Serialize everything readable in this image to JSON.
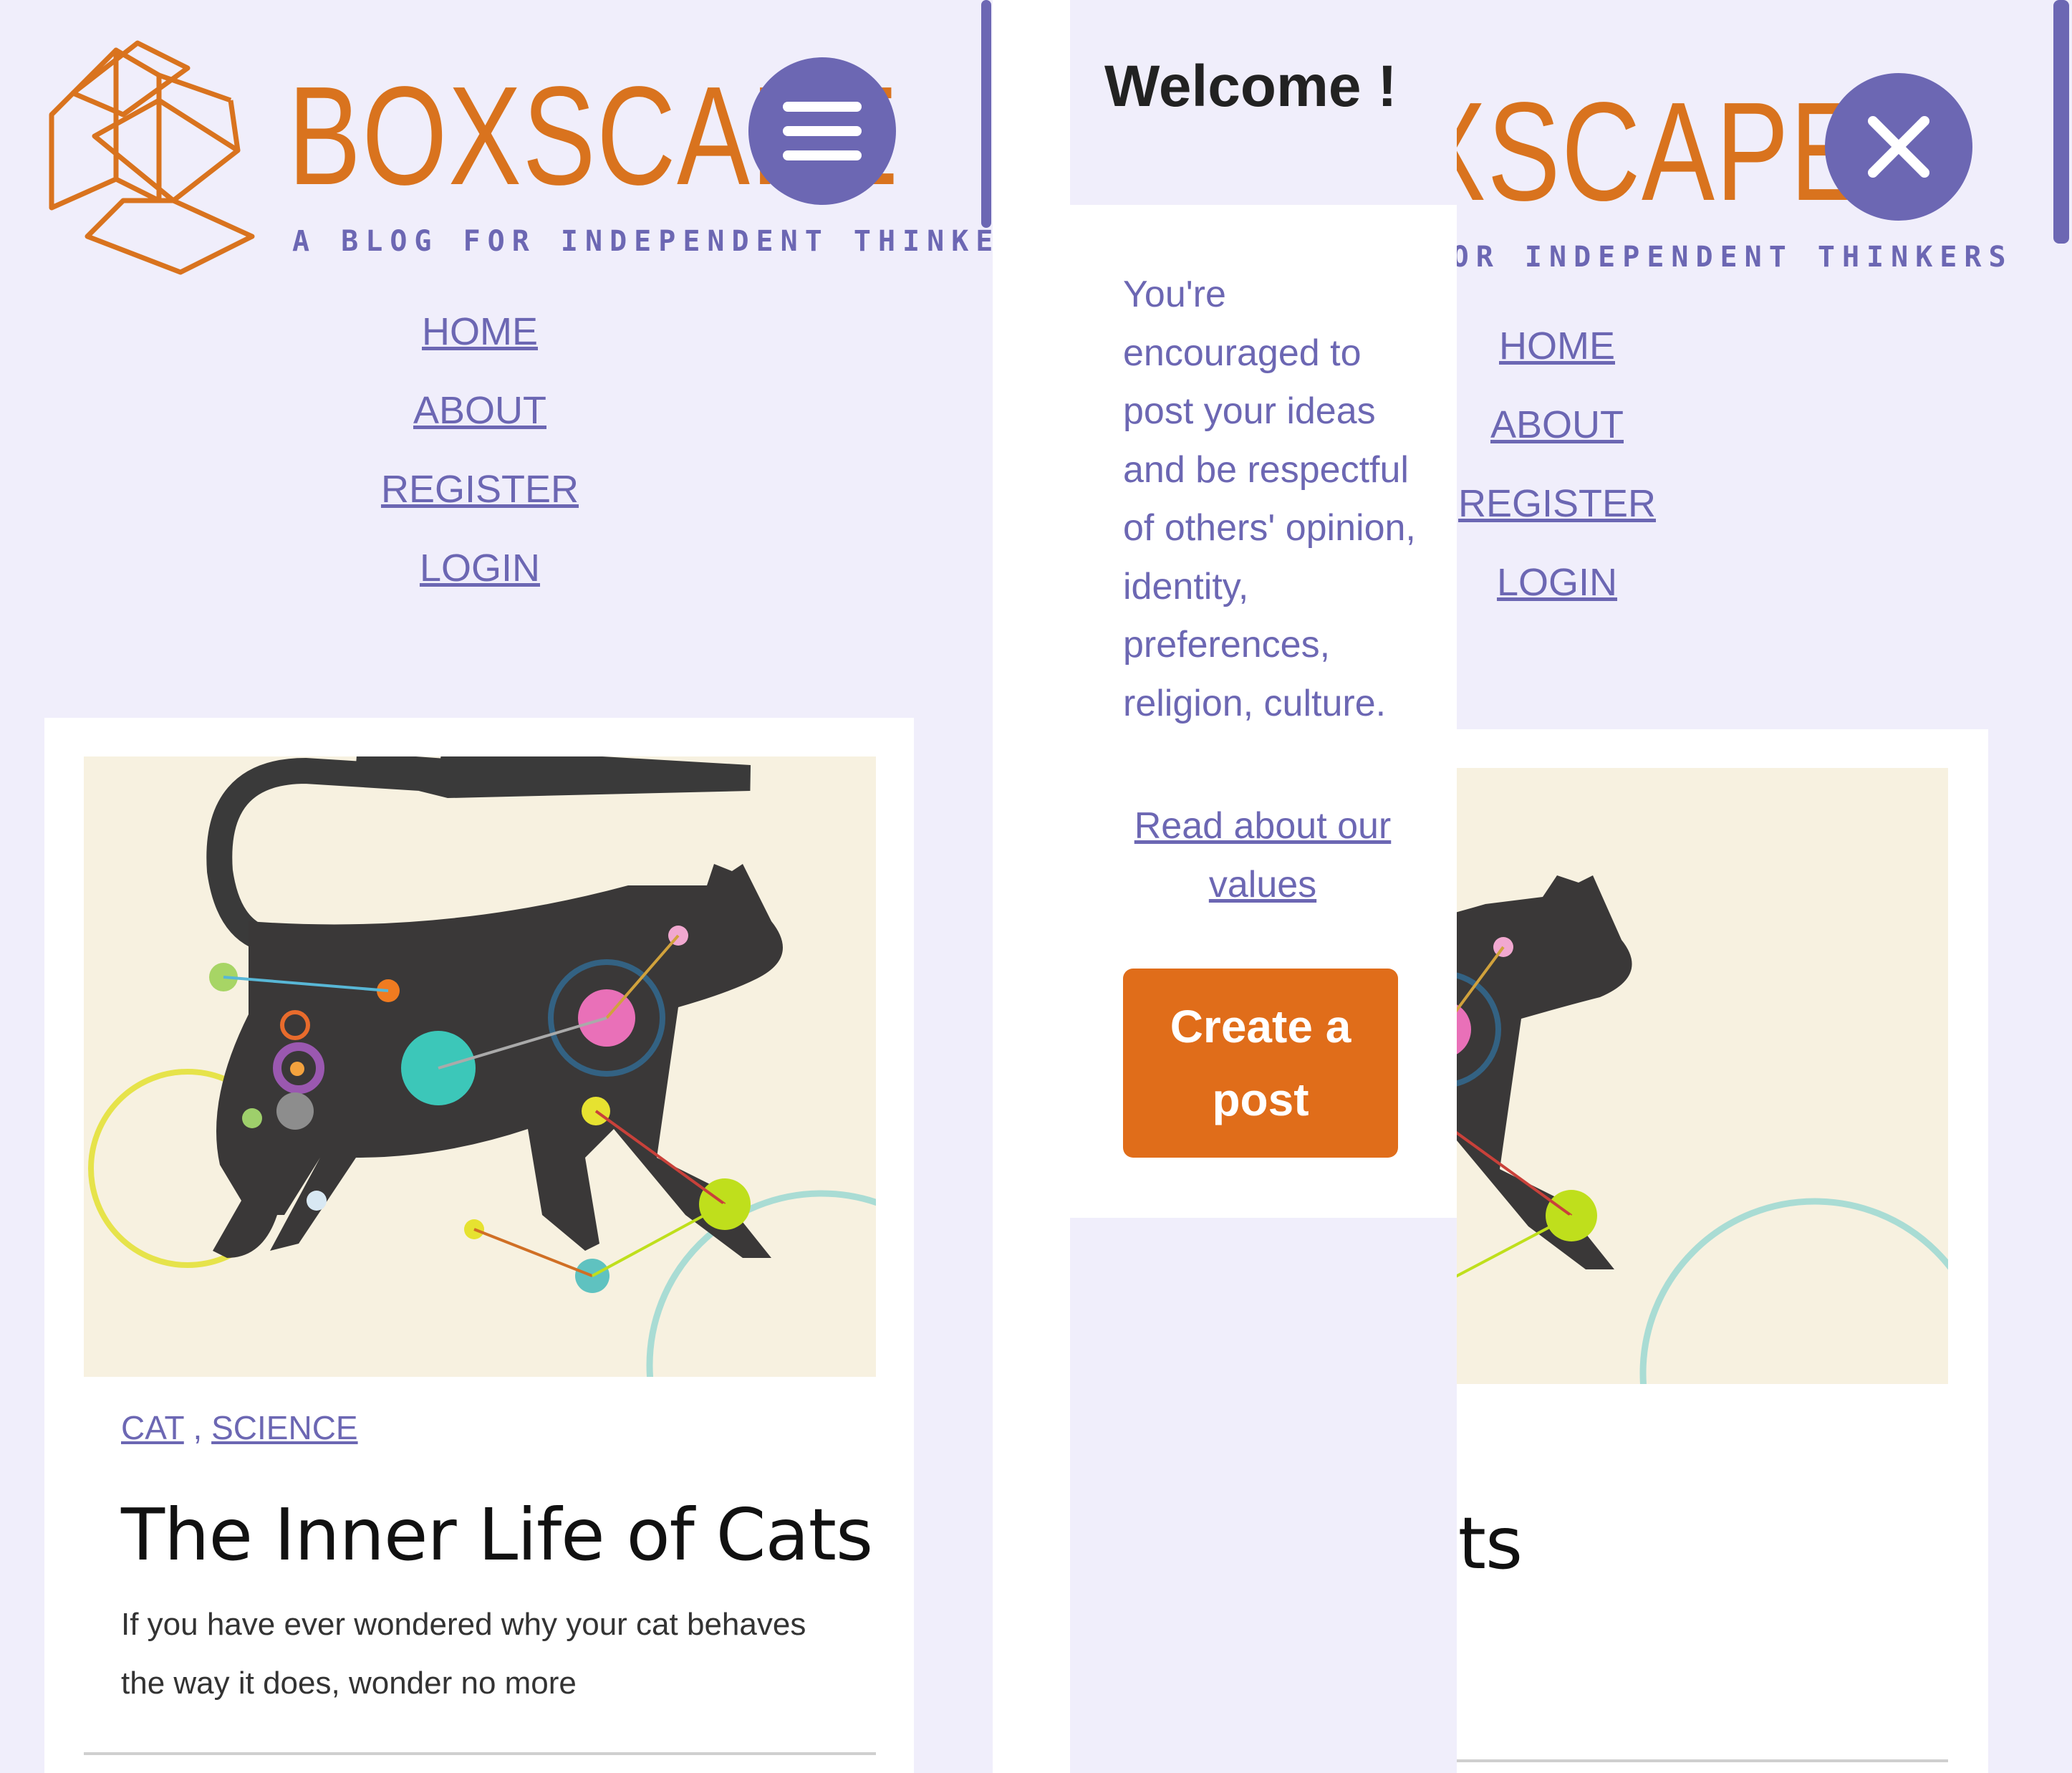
{
  "site": {
    "brand_name": "BOXSCAPE",
    "tagline": "A BLOG FOR INDEPENDENT THINKERS"
  },
  "nav": {
    "items": [
      {
        "label": "HOME"
      },
      {
        "label": "ABOUT"
      },
      {
        "label": "REGISTER"
      },
      {
        "label": "LOGIN"
      }
    ]
  },
  "post": {
    "categories": [
      "CAT",
      "SCIENCE"
    ],
    "category_separator": ",",
    "title": "The Inner Life of Cats",
    "excerpt": "If you have ever wondered why your cat behaves the way it does, wonder no more"
  },
  "drawer": {
    "title": "Welcome !",
    "message": "You're encouraged to post your ideas and be respectful of others' opinion, identity, preferences, religion, culture.",
    "values_link": "Read about our values",
    "create_button": "Create a post"
  },
  "icons": {
    "menu": "hamburger-menu-icon",
    "close": "close-icon",
    "logo": "box-logo-icon"
  },
  "colors": {
    "background": "#f0eefb",
    "accent": "#6c67b3",
    "brand_orange": "#d9731e",
    "button_orange": "#e06d1a",
    "card": "#ffffff"
  }
}
